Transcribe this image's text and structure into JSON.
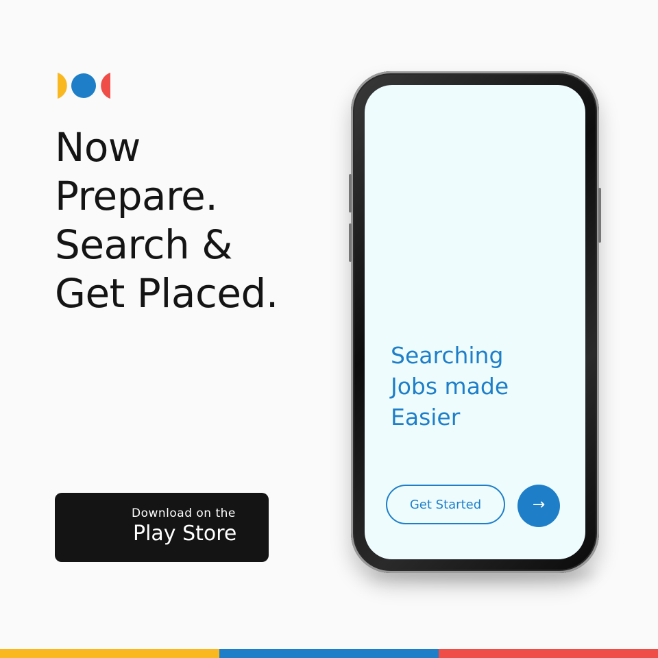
{
  "brand": {
    "colors": {
      "yellow": "#f9b820",
      "blue": "#1e7fc8",
      "red": "#ef4d47",
      "dark": "#141414",
      "screen_bg": "#effcfe"
    },
    "logo_icon": "three-dot-logo-icon"
  },
  "headline": {
    "lines": [
      "Now",
      "Prepare.",
      "Search &",
      "Get Placed."
    ]
  },
  "store_button": {
    "top_text": "Download on the",
    "main_text": "Play Store"
  },
  "phone_screen": {
    "title_lines": [
      "Searching",
      "Jobs made",
      "Easier"
    ],
    "get_started_label": "Get Started",
    "next_icon": "→"
  }
}
